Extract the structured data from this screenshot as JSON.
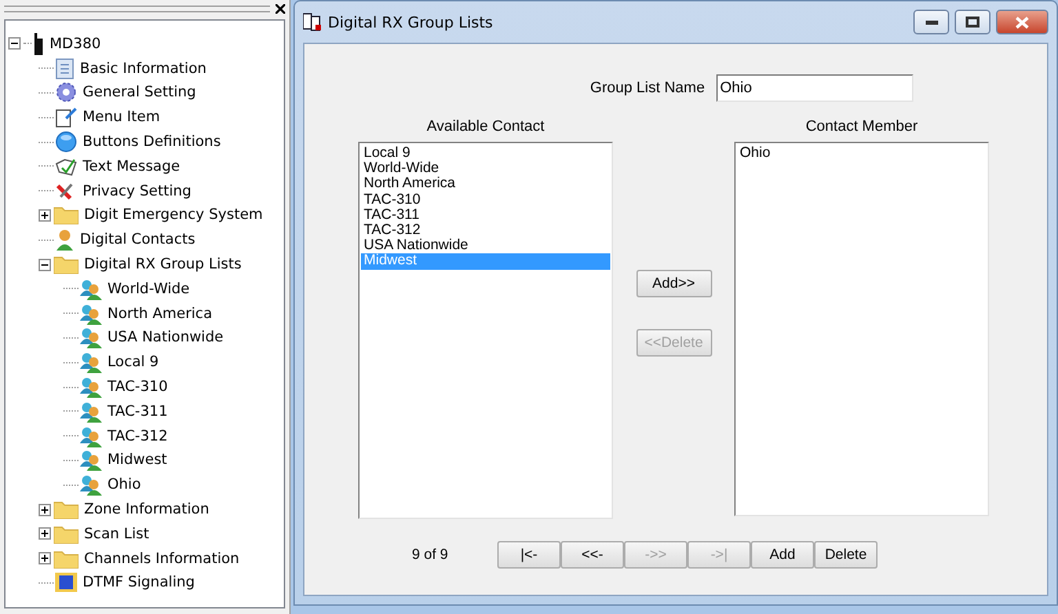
{
  "tree": {
    "label": "MD380",
    "kind": "radio",
    "expanded": true,
    "children": [
      {
        "label": "Basic Information",
        "kind": "doc"
      },
      {
        "label": "General Setting",
        "kind": "gear"
      },
      {
        "label": "Menu Item",
        "kind": "menu"
      },
      {
        "label": "Buttons Definitions",
        "kind": "circle"
      },
      {
        "label": "Text Message",
        "kind": "message"
      },
      {
        "label": "Privacy Setting",
        "kind": "privacy"
      },
      {
        "label": "Digit Emergency System",
        "kind": "folder",
        "expanded": false
      },
      {
        "label": "Digital Contacts",
        "kind": "contact"
      },
      {
        "label": "Digital RX Group Lists",
        "kind": "folder",
        "expanded": true,
        "children": [
          {
            "label": "World-Wide",
            "kind": "group"
          },
          {
            "label": "North America",
            "kind": "group"
          },
          {
            "label": "USA Nationwide",
            "kind": "group"
          },
          {
            "label": "Local 9",
            "kind": "group"
          },
          {
            "label": "TAC-310",
            "kind": "group"
          },
          {
            "label": "TAC-311",
            "kind": "group"
          },
          {
            "label": "TAC-312",
            "kind": "group"
          },
          {
            "label": "Midwest",
            "kind": "group"
          },
          {
            "label": "Ohio",
            "kind": "group"
          }
        ]
      },
      {
        "label": "Zone Information",
        "kind": "folder",
        "expanded": false
      },
      {
        "label": "Scan List",
        "kind": "folder",
        "expanded": false
      },
      {
        "label": "Channels Information",
        "kind": "folder",
        "expanded": false
      },
      {
        "label": "DTMF Signaling",
        "kind": "dtmf"
      }
    ]
  },
  "window": {
    "title": "Digital RX Group Lists"
  },
  "group_list_name": {
    "label": "Group List Name",
    "value": "Ohio"
  },
  "available_contact": {
    "label": "Available Contact",
    "items": [
      {
        "text": "Local 9",
        "selected": false
      },
      {
        "text": "World-Wide",
        "selected": false
      },
      {
        "text": "North America",
        "selected": false
      },
      {
        "text": "TAC-310",
        "selected": false
      },
      {
        "text": "TAC-311",
        "selected": false
      },
      {
        "text": "TAC-312",
        "selected": false
      },
      {
        "text": "USA Nationwide",
        "selected": false
      },
      {
        "text": "Midwest",
        "selected": true
      }
    ]
  },
  "contact_member": {
    "label": "Contact Member",
    "items": [
      {
        "text": "Ohio",
        "selected": false
      }
    ]
  },
  "transfer_buttons": [
    {
      "label": "Add>>",
      "disabled": false
    },
    {
      "label": "<<Delete",
      "disabled": true
    }
  ],
  "record_position": "9 of 9",
  "nav_buttons": [
    {
      "label": "|<-",
      "disabled": false
    },
    {
      "label": "<<-",
      "disabled": false
    },
    {
      "label": "->>",
      "disabled": true
    },
    {
      "label": "->|",
      "disabled": true
    },
    {
      "label": "Add",
      "disabled": false
    },
    {
      "label": "Delete",
      "disabled": false
    }
  ]
}
